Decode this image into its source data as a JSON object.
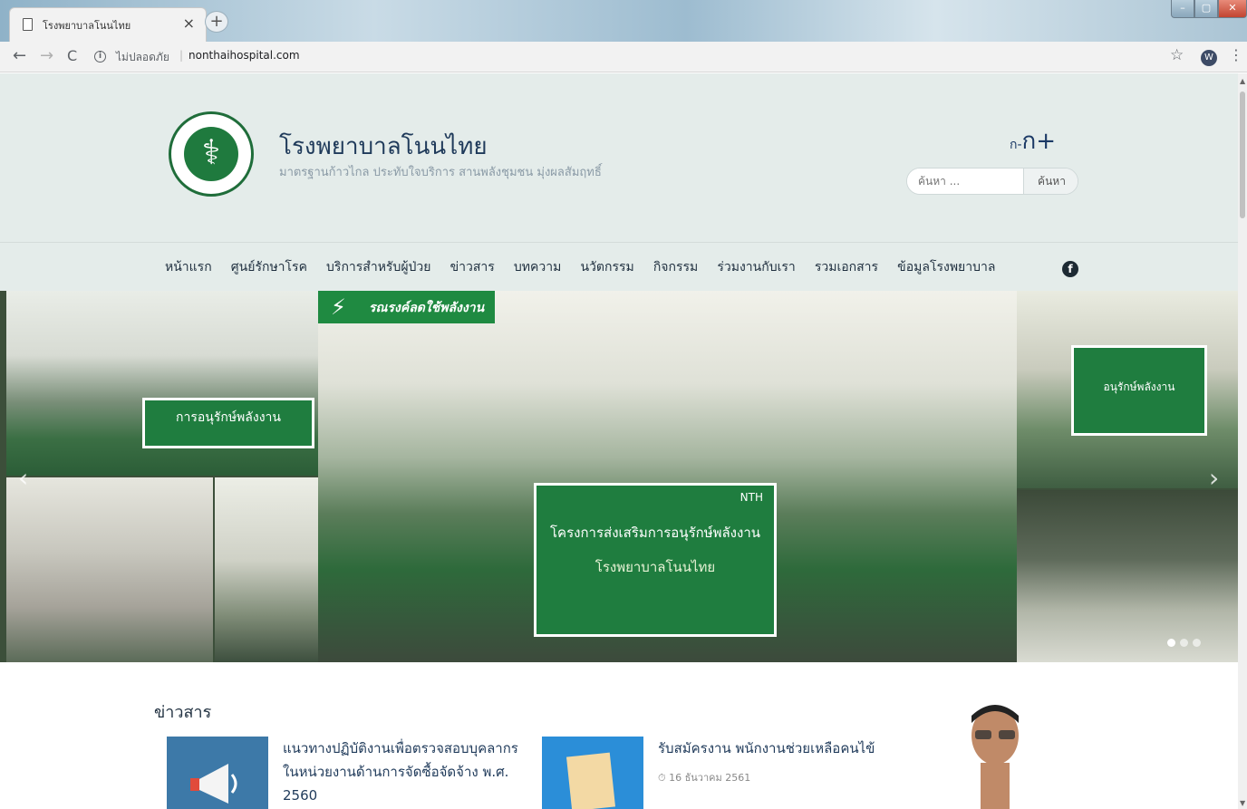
{
  "browser": {
    "tab_title": "โรงพยาบาลโนนไทย",
    "tab_close": "×",
    "new_tab": "+",
    "back": "←",
    "forward": "→",
    "reload": "C",
    "security_text": "ไม่ปลอดภัย",
    "separator": "|",
    "url": "nonthaihospital.com",
    "bookmark_star": "☆",
    "profile_initial": "W",
    "menu": "⋮",
    "window_min": "–",
    "window_max": "▢",
    "window_close": "✕"
  },
  "header": {
    "site_title": "โรงพยาบาลโนนไทย",
    "tagline": "มาตรฐานก้าวไกล ประทับใจบริการ สานพลังชุมชน มุ่งผลสัมฤทธิ์",
    "font_decrease": "ก-",
    "font_increase": "ก+",
    "search_placeholder": "ค้นหา ...",
    "search_button": "ค้นหา"
  },
  "nav": {
    "items": [
      {
        "label": "หน้าแรก"
      },
      {
        "label": "ศูนย์รักษาโรค"
      },
      {
        "label": "บริการสำหรับผู้ป่วย"
      },
      {
        "label": "ข่าวสาร"
      },
      {
        "label": "บทความ"
      },
      {
        "label": "นวัตกรรม"
      },
      {
        "label": "กิจกรรม"
      },
      {
        "label": "ร่วมงานกับเรา"
      },
      {
        "label": "รวมเอกสาร"
      },
      {
        "label": "ข้อมูลโรงพยาบาล"
      }
    ],
    "facebook_glyph": "f"
  },
  "slider": {
    "badge_text": "รณรงค์ลดใช้พลังงาน",
    "sign_main_line1": "โครงการส่งเสริมการอนุรักษ์พลังงาน",
    "sign_main_line2": "โรงพยาบาลโนนไทย",
    "sign_left": "การอนุรักษ์พลังงาน",
    "sign_right": "อนุรักษ์พลังงาน",
    "sign_nth": "NTH",
    "prev": "‹",
    "next": "›",
    "slide_count": 3,
    "active_slide": 1
  },
  "news": {
    "heading": "ข่าวสาร",
    "items": [
      {
        "title": "แนวทางปฏิบัติงานเพื่อตรวจสอบบุคลากร ในหน่วยงานด้านการจัดซื้อจัดจ้าง พ.ศ. 2560",
        "date": ""
      },
      {
        "title": "รับสมัครงาน พนักงานช่วยเหลือคนไข้",
        "date": "16 ธันวาคม 2561"
      }
    ]
  },
  "colors": {
    "header_bg": "#e4ecea",
    "brand_green": "#1f7a3e",
    "title_blue": "#1f3a5a"
  }
}
